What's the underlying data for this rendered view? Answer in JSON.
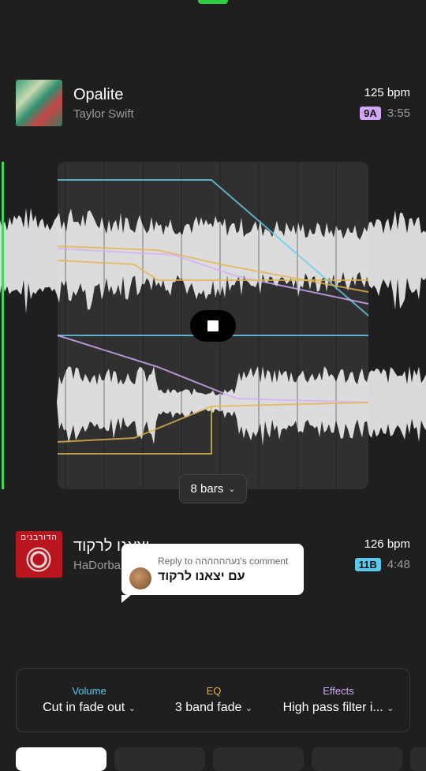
{
  "track_a": {
    "title": "Opalite",
    "artist": "Taylor Swift",
    "bpm": "125 bpm",
    "key": "9A",
    "duration": "3:55",
    "key_color": "#d2a8f5"
  },
  "track_b": {
    "title": "יצאנו לרקוד",
    "artist": "HaDorba",
    "art_text": "הדורבנים",
    "bpm": "126 bpm",
    "key": "11B",
    "duration": "4:48",
    "key_color": "#5bc8e8"
  },
  "player": {
    "stop_icon": "stop-icon",
    "bars_label": "8 bars",
    "playhead_color": "#3ddc56"
  },
  "comment": {
    "reply_label": "Reply to נעהההההה's comment",
    "text": "עם יצאנו לרקוד"
  },
  "controls": {
    "volume": {
      "label": "Volume",
      "value": "Cut in fade out",
      "color": "#5bc8e8"
    },
    "eq": {
      "label": "EQ",
      "value": "3 band fade",
      "color": "#e0b040"
    },
    "effects": {
      "label": "Effects",
      "value": "High pass filter i...",
      "color": "#d2a8f5"
    }
  },
  "chevron": "⌄"
}
